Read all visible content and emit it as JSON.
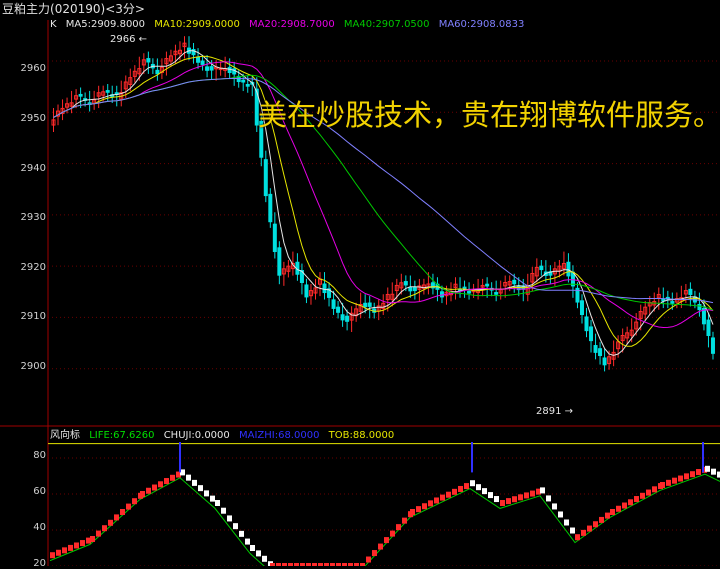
{
  "title": "豆粕主力",
  "code": "(020190)",
  "period": "<3分>",
  "ma_bar": {
    "k": "K",
    "items": [
      {
        "text": "MA5:2909.8000",
        "color": "#e6e6e6"
      },
      {
        "text": "MA10:2909.0000",
        "color": "#e6e600"
      },
      {
        "text": "MA20:2908.7000",
        "color": "#e600e6"
      },
      {
        "text": "MA40:2907.0500",
        "color": "#00c800"
      },
      {
        "text": "MA60:2908.0833",
        "color": "#8080ff"
      }
    ]
  },
  "price_axis": [
    "2960",
    "2950",
    "2940",
    "2930",
    "2920",
    "2910",
    "2900"
  ],
  "markers": {
    "high": "2966",
    "low": "2891"
  },
  "ad_text": "美在炒股技术，贵在翔博软件服务。",
  "indicator": {
    "name": "风向标",
    "items": [
      {
        "text": "LIFE:67.6260",
        "color": "#00e000"
      },
      {
        "text": "CHUJI:0.0000",
        "color": "#e6e6e6"
      },
      {
        "text": "MAIZHI:68.0000",
        "color": "#3030ff"
      },
      {
        "text": "TOB:88.0000",
        "color": "#e6e600"
      }
    ],
    "axis": [
      "80",
      "60",
      "40",
      "20"
    ]
  },
  "colors": {
    "up": "#ff2a2a",
    "down": "#00e0e0",
    "grid": "#6a0000",
    "axis": "#a00000"
  },
  "chart_data": {
    "type": "line",
    "ylim": [
      2890,
      2968
    ],
    "segments": [
      {
        "o": 2948,
        "c": 2951
      },
      {
        "o": 2951,
        "c": 2953
      },
      {
        "o": 2953,
        "c": 2952
      },
      {
        "o": 2952,
        "c": 2954
      },
      {
        "o": 2954,
        "c": 2953
      },
      {
        "o": 2953,
        "c": 2957
      },
      {
        "o": 2957,
        "c": 2960
      },
      {
        "o": 2960,
        "c": 2958
      },
      {
        "o": 2958,
        "c": 2961
      },
      {
        "o": 2961,
        "c": 2963
      },
      {
        "o": 2963,
        "c": 2960
      },
      {
        "o": 2960,
        "c": 2958
      },
      {
        "o": 2958,
        "c": 2959
      },
      {
        "o": 2959,
        "c": 2956
      },
      {
        "o": 2956,
        "c": 2955
      },
      {
        "o": 2955,
        "c": 2934
      },
      {
        "o": 2934,
        "c": 2918
      },
      {
        "o": 2918,
        "c": 2921
      },
      {
        "o": 2921,
        "c": 2914
      },
      {
        "o": 2914,
        "c": 2917
      },
      {
        "o": 2917,
        "c": 2912
      },
      {
        "o": 2912,
        "c": 2909
      },
      {
        "o": 2909,
        "c": 2913
      },
      {
        "o": 2913,
        "c": 2911
      },
      {
        "o": 2911,
        "c": 2914
      },
      {
        "o": 2914,
        "c": 2917
      },
      {
        "o": 2917,
        "c": 2915
      },
      {
        "o": 2915,
        "c": 2917
      },
      {
        "o": 2917,
        "c": 2914
      },
      {
        "o": 2914,
        "c": 2916
      },
      {
        "o": 2916,
        "c": 2915
      },
      {
        "o": 2915,
        "c": 2916
      },
      {
        "o": 2916,
        "c": 2915
      },
      {
        "o": 2915,
        "c": 2917
      },
      {
        "o": 2917,
        "c": 2915
      },
      {
        "o": 2915,
        "c": 2920
      },
      {
        "o": 2920,
        "c": 2918
      },
      {
        "o": 2918,
        "c": 2921
      },
      {
        "o": 2921,
        "c": 2913
      },
      {
        "o": 2913,
        "c": 2905
      },
      {
        "o": 2905,
        "c": 2901
      },
      {
        "o": 2901,
        "c": 2905
      },
      {
        "o": 2905,
        "c": 2908
      },
      {
        "o": 2908,
        "c": 2912
      },
      {
        "o": 2912,
        "c": 2914
      },
      {
        "o": 2914,
        "c": 2913
      },
      {
        "o": 2913,
        "c": 2915
      },
      {
        "o": 2915,
        "c": 2912
      },
      {
        "o": 2912,
        "c": 2903
      }
    ],
    "indicator_ylim": [
      20,
      90
    ]
  }
}
